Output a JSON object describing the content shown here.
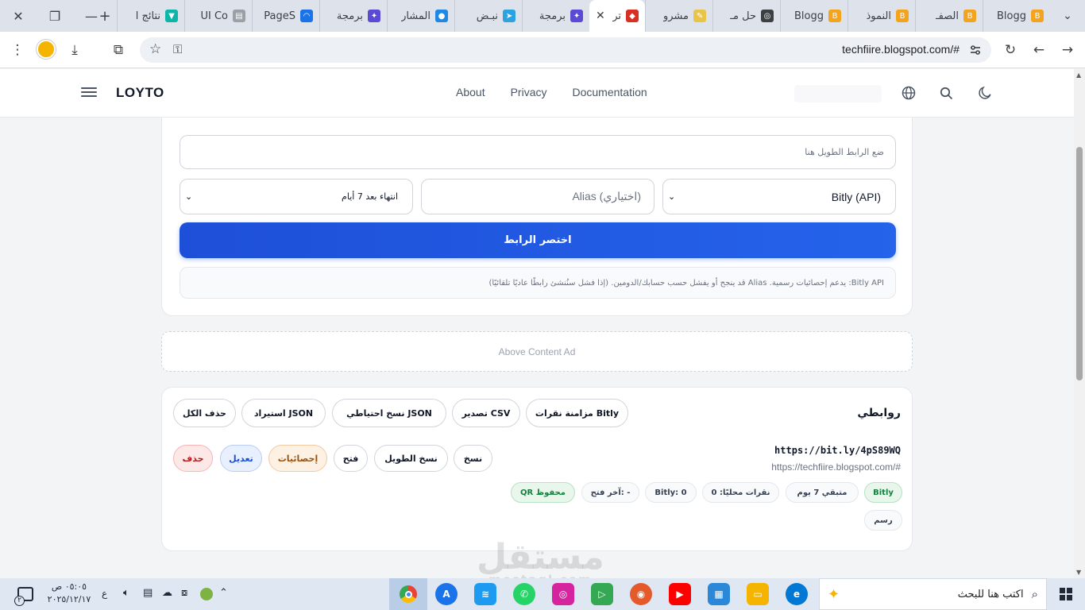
{
  "browser": {
    "tabs": [
      {
        "label": "Blogg",
        "fav_color": "#f4a31c",
        "fav_glyph": "B"
      },
      {
        "label": "الصفـ",
        "fav_color": "#f4a31c",
        "fav_glyph": "B"
      },
      {
        "label": "النموذ",
        "fav_color": "#f4a31c",
        "fav_glyph": "B"
      },
      {
        "label": "Blogg",
        "fav_color": "#f4a31c",
        "fav_glyph": "B"
      },
      {
        "label": "حل مـ",
        "fav_color": "#3c4043",
        "fav_glyph": "◎"
      },
      {
        "label": "مشرو",
        "fav_color": "#e8c547",
        "fav_glyph": "✎"
      },
      {
        "label": "تر",
        "fav_color": "#d93025",
        "fav_glyph": "◆"
      },
      {
        "label": "برمجة",
        "fav_color": "#5b4bd4",
        "fav_glyph": "✦"
      },
      {
        "label": "نبـض",
        "fav_color": "#2aa3e0",
        "fav_glyph": "➤"
      },
      {
        "label": "المشار",
        "fav_color": "#1e88e5",
        "fav_glyph": "●"
      },
      {
        "label": "برمجة",
        "fav_color": "#5b4bd4",
        "fav_glyph": "✦"
      },
      {
        "label": "PageS",
        "fav_color": "#1a73e8",
        "fav_glyph": "◠"
      },
      {
        "label": "UI Co",
        "fav_color": "#9aa0a6",
        "fav_glyph": "▤"
      },
      {
        "label": "نتائج ا",
        "fav_color": "#0bb5a8",
        "fav_glyph": "▼"
      }
    ],
    "url": "techfiire.blogspot.com/#"
  },
  "site": {
    "logo": "LOYTO",
    "nav": [
      "About",
      "Privacy",
      "Documentation"
    ]
  },
  "shortener": {
    "long_url_placeholder": "ضع الرابط الطويل هنا",
    "provider": "Bitly (API)",
    "alias_placeholder": "Alias (اختياري)",
    "expiry": "انتهاء بعد 7 أيام",
    "submit": "اختصر الرابط",
    "note": "Bitly API: يدعم إحصائيات رسمية. Alias قد ينجح أو يفشل حسب حسابك/الدومين.   (إذا فشل سنُنشئ رابطًا عاديًا تلقائيًا)"
  },
  "ad": {
    "label": "Above Content Ad"
  },
  "links": {
    "title": "روابطي",
    "actions": [
      "مزامنة نقرات Bitly",
      "تصدير CSV",
      "نسخ احتياطي JSON",
      "استيراد JSON",
      "حذف الكل"
    ],
    "item": {
      "short_url": "https://bit.ly/4pS89WQ",
      "original_url": "https://techfiire.blogspot.com/#",
      "buttons": {
        "copy": "نسخ",
        "copy_long": "نسخ الطويل",
        "open": "فتح",
        "stats": "إحصائيات",
        "edit": "تعديل",
        "delete": "حذف"
      },
      "badges": {
        "provider": "Bitly",
        "remaining": "متبقي 7 يوم",
        "local_clicks": "نقرات محليًا: 0",
        "bitly_clicks": "Bitly: 0",
        "last_open": "آخر فتح: -",
        "qr": "QR محفوظ",
        "chart": "رسم"
      }
    }
  },
  "taskbar": {
    "search_placeholder": "اكتب هنا للبحث",
    "time": "٠٥:٠٥ ص",
    "date": "٢٠٢٥/١٢/١٧",
    "lang": "ع",
    "notif_count": "٢"
  },
  "watermark": {
    "main": "مستقل",
    "sub": "mostaql.com"
  },
  "colors": {
    "accent": "#2563eb",
    "delete": "#b91c1c",
    "stats": "#9a5416",
    "edit": "#1d4ed8",
    "qr": "#15803d"
  }
}
